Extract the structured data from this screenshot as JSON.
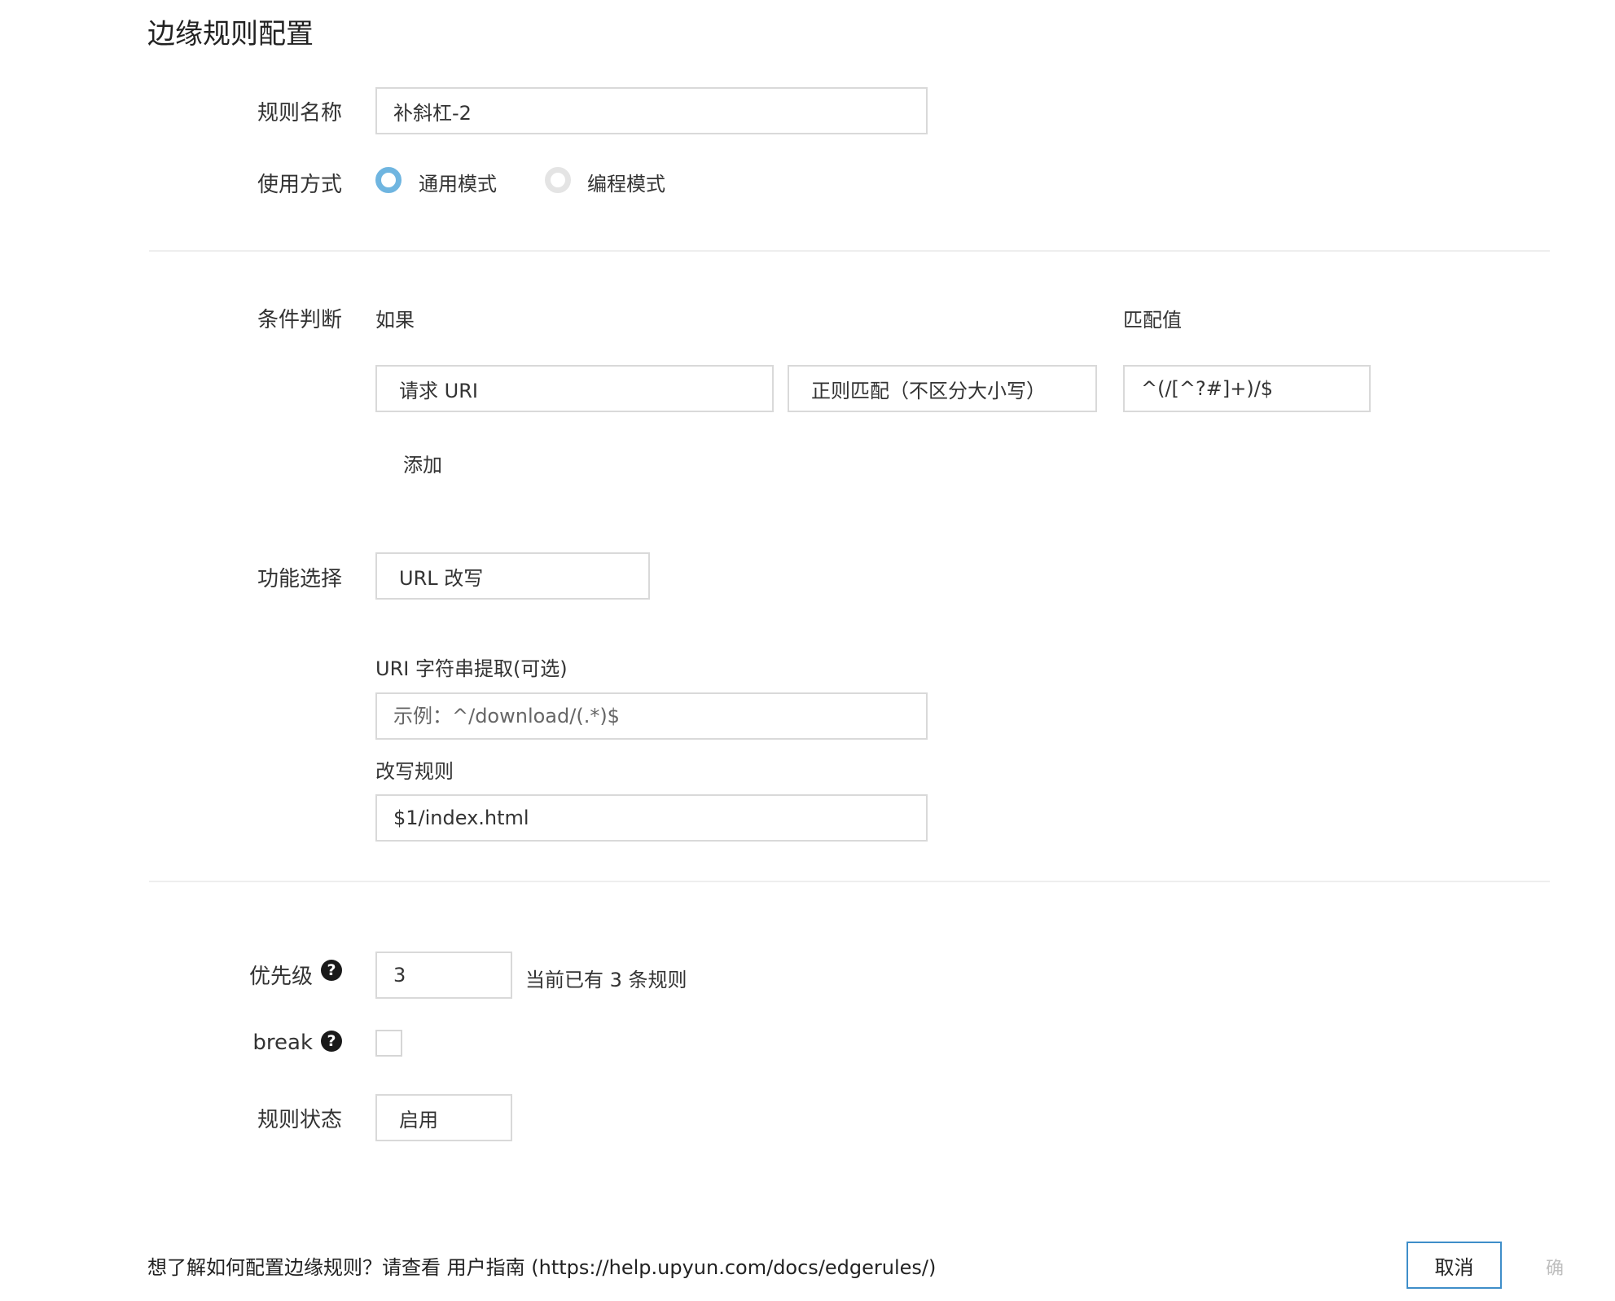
{
  "page": {
    "title": "边缘规则配置"
  },
  "form": {
    "rule_name": {
      "label": "规则名称",
      "value": "补斜杠-2"
    },
    "mode": {
      "label": "使用方式",
      "options": [
        {
          "label": "通用模式",
          "selected": true
        },
        {
          "label": "编程模式",
          "selected": false
        }
      ]
    },
    "condition": {
      "label": "条件判断",
      "if_label": "如果",
      "match_value_label": "匹配值",
      "variable": "请求 URI",
      "operator": "正则匹配（不区分大小写）",
      "match_value": "^(/[^?#]+)/$",
      "add_label": "添加"
    },
    "feature": {
      "label": "功能选择",
      "value": "URL 改写",
      "extract_label": "URI 字符串提取(可选)",
      "extract_placeholder": "示例：^/download/(.*)$",
      "rewrite_label": "改写规则",
      "rewrite_value": "$1/index.html"
    },
    "priority": {
      "label": "优先级",
      "value": "3",
      "note": "当前已有 3 条规则"
    },
    "break": {
      "label": "break",
      "checked": false
    },
    "status": {
      "label": "规则状态",
      "value": "启用"
    }
  },
  "footer": {
    "help_text": "想了解如何配置边缘规则？请查看 用户指南 (https://help.upyun.com/docs/edgerules/)",
    "cancel_label": "取消",
    "confirm_label": "确"
  },
  "colors": {
    "accent": "#3f8ec9",
    "radio_selected": "#6fb5e0",
    "border": "#d9d9d9"
  },
  "icons": {
    "help": "question-circle-icon"
  }
}
